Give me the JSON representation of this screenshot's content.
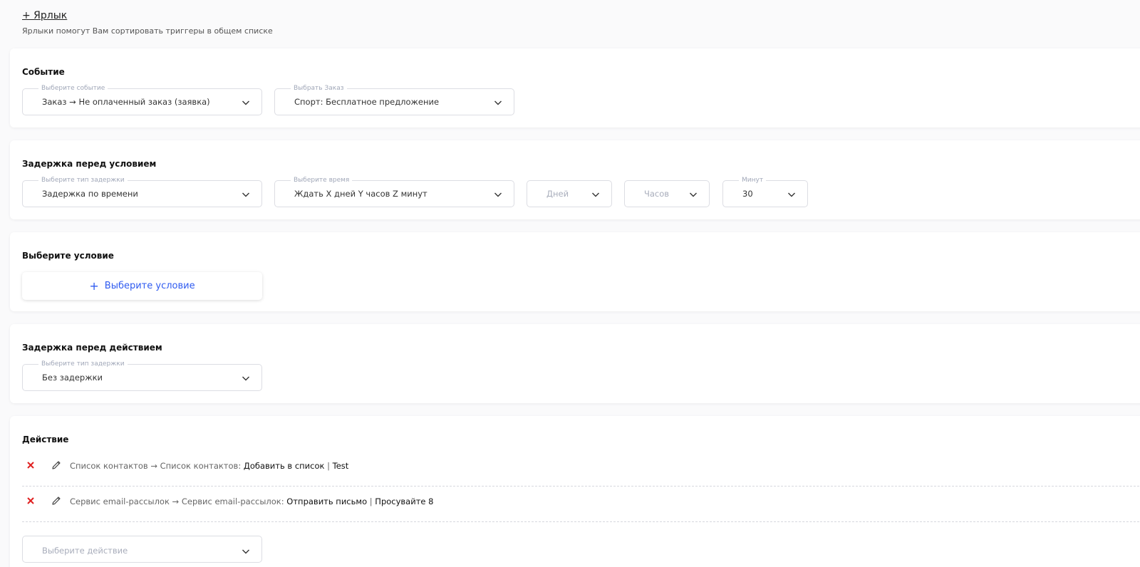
{
  "labels": {
    "add_label": "+ Ярлык",
    "hint": "Ярлыки помогут Вам сортировать триггеры в общем списке"
  },
  "event": {
    "title": "Событие",
    "event_select": {
      "legend": "Выберите событие",
      "value": "Заказ → Не оплаченный заказ (заявка)"
    },
    "order_select": {
      "legend": "Выбрать Заказ",
      "value": "Спорт: Бесплатное предложение"
    }
  },
  "delay_before_condition": {
    "title": "Задержка перед условием",
    "type_select": {
      "legend": "Выберите тип задержки",
      "value": "Задержка по времени"
    },
    "time_select": {
      "legend": "Выберите время",
      "value": "Ждать X дней Y часов Z минут"
    },
    "days_select": {
      "placeholder": "Дней"
    },
    "hours_select": {
      "placeholder": "Часов"
    },
    "minutes_select": {
      "legend": "Минут",
      "value": "30"
    }
  },
  "condition": {
    "title": "Выберите условие",
    "add_button": "Выберите условие"
  },
  "delay_before_action": {
    "title": "Задержка перед действием",
    "type_select": {
      "legend": "Выберите тип задержки",
      "value": "Без задержки"
    }
  },
  "action": {
    "title": "Действие",
    "items": [
      {
        "source": "Список контактов → Список контактов: ",
        "operation": "Добавить в список",
        "separator": " | ",
        "target": "Test"
      },
      {
        "source": "Сервис email-рассылок → Сервис email-рассылок: ",
        "operation": "Отправить письмо",
        "separator": " | ",
        "target": "Просувайте 8"
      }
    ],
    "select_placeholder": "Выберите действие"
  },
  "colors": {
    "accent": "#2f5bf0",
    "delete": "#e02020",
    "border": "#dcdde3"
  }
}
